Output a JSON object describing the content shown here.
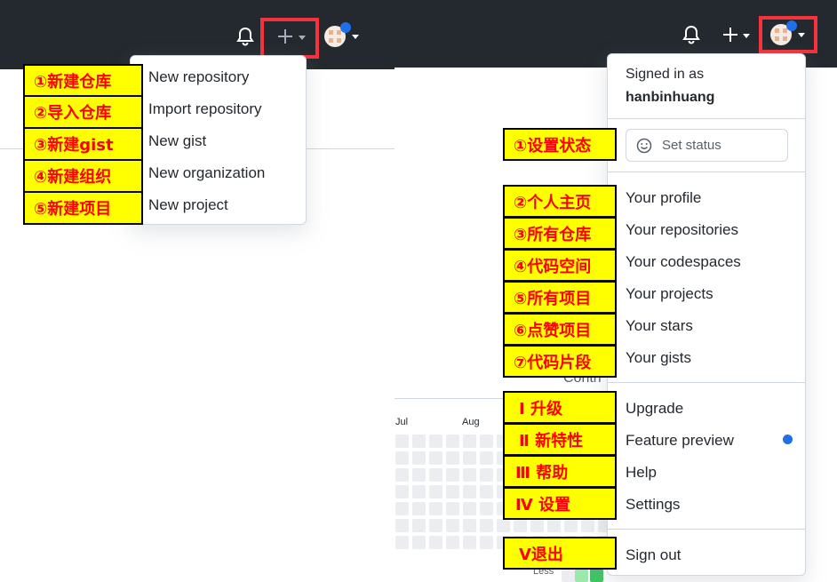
{
  "left": {
    "create_menu": [
      "New repository",
      "Import repository",
      "New gist",
      "New organization",
      "New project"
    ],
    "annotations": [
      "①新建仓库",
      "②导入仓库",
      "③新建gist",
      "④新建组织",
      "⑤新建项目"
    ]
  },
  "right": {
    "signed_in_label": "Signed in as",
    "username": "hanbinhuang",
    "set_status": "Set status",
    "group1": [
      "Your profile",
      "Your repositories",
      "Your codespaces",
      "Your projects",
      "Your stars",
      "Your gists"
    ],
    "group2": [
      "Upgrade",
      "Feature preview",
      "Help",
      "Settings"
    ],
    "sign_out": "Sign out",
    "annotations_status": "①设置状态",
    "annotations_group1": [
      "②个人主页",
      "③所有仓库",
      "④代码空间",
      "⑤所有项目",
      "⑥点赞项目",
      "⑦代码片段"
    ],
    "annotations_group2": [
      "Ⅰ 升级",
      "Ⅱ 新特性",
      "Ⅲ 帮助",
      "Ⅳ 设置"
    ],
    "annotation_signout": "Ⅴ退出",
    "background": {
      "contrib_text": "Contri",
      "months": [
        "Jul",
        "Aug"
      ],
      "legend_less": "Less"
    }
  },
  "colors": {
    "header": "#24292f",
    "highlight": "#f4333b",
    "label_bg": "#ffff00",
    "label_text": "#ff0000",
    "accent_dot": "#1f6feb"
  }
}
